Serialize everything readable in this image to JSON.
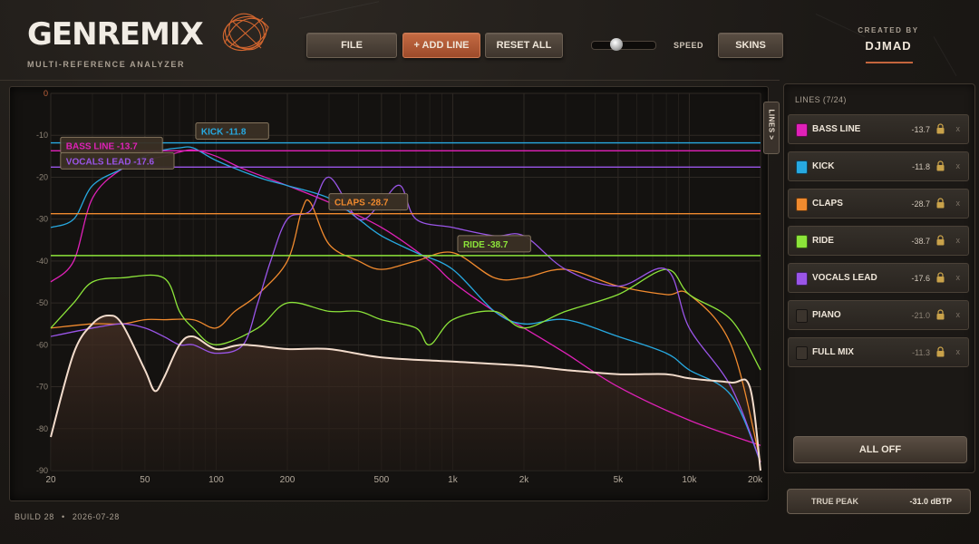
{
  "header": {
    "logo_text": "GENREMIX",
    "subtitle": "MULTI-REFERENCE ANALYZER",
    "buttons": {
      "file": "FILE",
      "add_line": "+ ADD LINE",
      "reset_all": "RESET ALL",
      "skins": "SKINS"
    },
    "speed_label": "SPEED",
    "speed_level": 0.38,
    "created_by_label": "CREATED BY",
    "author": "DJMAD"
  },
  "graph": {
    "lines_tab_label": "LINES >",
    "callouts": [
      {
        "name": "BASS LINE",
        "value": "-13.7"
      },
      {
        "name": "VOCALS LEAD",
        "value": "-17.6"
      },
      {
        "name": "KICK",
        "value": "-11.8"
      },
      {
        "name": "CLAPS",
        "value": "-28.7"
      },
      {
        "name": "RIDE",
        "value": "-38.7"
      }
    ]
  },
  "panel": {
    "heading": "LINES",
    "count": "(7/24)",
    "rows": [
      {
        "name": "BASS LINE",
        "value": "-13.7",
        "color": "#e021b8",
        "active": true
      },
      {
        "name": "KICK",
        "value": "-11.8",
        "color": "#27a9e1",
        "active": true
      },
      {
        "name": "CLAPS",
        "value": "-28.7",
        "color": "#f08a2e",
        "active": true
      },
      {
        "name": "RIDE",
        "value": "-38.7",
        "color": "#8ce43a",
        "active": true
      },
      {
        "name": "VOCALS LEAD",
        "value": "-17.6",
        "color": "#9a55e8",
        "active": true
      },
      {
        "name": "PIANO",
        "value": "-21.0",
        "color": "#3b342d",
        "active": false
      },
      {
        "name": "FULL MIX",
        "value": "-11.3",
        "color": "#3b342d",
        "active": false
      }
    ],
    "all_off_label": "ALL OFF"
  },
  "true_peak": {
    "label": "TRUE PEAK",
    "value": "-31.0 dBTP"
  },
  "footer": {
    "build": "BUILD 28",
    "date": "2026-07-28",
    "separator": "•"
  },
  "chart_data": {
    "type": "line",
    "x_scale": "log",
    "xlim": [
      20,
      20000
    ],
    "ylim": [
      -90,
      0
    ],
    "x_ticks": [
      "20",
      "50",
      "100",
      "200",
      "500",
      "1k",
      "2k",
      "5k",
      "10k",
      "20k"
    ],
    "y_ticks": [
      "0",
      "-10",
      "-20",
      "-30",
      "-40",
      "-50",
      "-60",
      "-70",
      "-80",
      "-90"
    ],
    "grid": true,
    "reference_lines": [
      {
        "name": "KICK",
        "value": -11.8,
        "color": "#27a9e1"
      },
      {
        "name": "BASS LINE",
        "value": -13.7,
        "color": "#e021b8"
      },
      {
        "name": "VOCALS LEAD",
        "value": -17.6,
        "color": "#9a55e8"
      },
      {
        "name": "CLAPS",
        "value": -28.7,
        "color": "#f08a2e"
      },
      {
        "name": "RIDE",
        "value": -38.7,
        "color": "#8ce43a"
      }
    ],
    "series": [
      {
        "name": "BASS LINE",
        "color": "#e021b8",
        "x": [
          20,
          25,
          30,
          40,
          50,
          60,
          70,
          80,
          100,
          130,
          200,
          300,
          500,
          800,
          1000,
          1500,
          2000,
          3000,
          5000,
          10000,
          20000
        ],
        "y": [
          -45,
          -40,
          -25,
          -18,
          -16,
          -15,
          -14,
          -13.5,
          -15,
          -18,
          -22,
          -26,
          -32,
          -40,
          -45,
          -52,
          -56,
          -62,
          -70,
          -78,
          -84
        ]
      },
      {
        "name": "KICK",
        "color": "#27a9e1",
        "x": [
          20,
          25,
          30,
          40,
          50,
          60,
          70,
          80,
          100,
          150,
          200,
          300,
          400,
          500,
          700,
          1000,
          1500,
          2000,
          3000,
          5000,
          8000,
          10000,
          15000,
          20000
        ],
        "y": [
          -32,
          -30,
          -22,
          -18,
          -15,
          -13.5,
          -13,
          -13,
          -16,
          -20,
          -22,
          -25,
          -30,
          -34,
          -38,
          -42,
          -52,
          -55,
          -54,
          -58,
          -62,
          -66,
          -72,
          -88
        ]
      },
      {
        "name": "CLAPS",
        "color": "#f08a2e",
        "x": [
          20,
          30,
          40,
          50,
          60,
          80,
          100,
          120,
          150,
          200,
          230,
          250,
          300,
          400,
          500,
          700,
          1000,
          1500,
          2000,
          3000,
          5000,
          8000,
          10000,
          15000,
          20000
        ],
        "y": [
          -56,
          -55,
          -55,
          -54,
          -54,
          -54,
          -56,
          -52,
          -48,
          -40,
          -28,
          -26,
          -36,
          -40,
          -42,
          -40,
          -38,
          -44,
          -44,
          -42,
          -46,
          -48,
          -48,
          -60,
          -88
        ]
      },
      {
        "name": "RIDE",
        "color": "#8ce43a",
        "x": [
          20,
          25,
          30,
          40,
          60,
          70,
          80,
          100,
          150,
          200,
          300,
          400,
          500,
          700,
          800,
          1000,
          1500,
          2000,
          3000,
          5000,
          8000,
          10000,
          15000,
          20000
        ],
        "y": [
          -56,
          -50,
          -45,
          -44,
          -44,
          -52,
          -56,
          -60,
          -56,
          -50,
          -52,
          -52,
          -54,
          -56,
          -60,
          -54,
          -52,
          -56,
          -52,
          -48,
          -42,
          -48,
          -54,
          -66
        ]
      },
      {
        "name": "VOCALS LEAD",
        "color": "#9a55e8",
        "x": [
          20,
          30,
          40,
          50,
          60,
          70,
          80,
          100,
          130,
          150,
          170,
          200,
          250,
          300,
          400,
          500,
          600,
          700,
          1000,
          1500,
          2000,
          3000,
          5000,
          8000,
          10000,
          15000,
          20000
        ],
        "y": [
          -58,
          -56,
          -55,
          -56,
          -58,
          -60,
          -60,
          -62,
          -60,
          -50,
          -40,
          -30,
          -28,
          -20,
          -30,
          -26,
          -22,
          -30,
          -32,
          -34,
          -34,
          -42,
          -46,
          -42,
          -56,
          -70,
          -88
        ]
      },
      {
        "name": "FULL MIX",
        "color": "#f3dccc",
        "x": [
          20,
          25,
          30,
          35,
          40,
          50,
          55,
          60,
          70,
          80,
          100,
          130,
          200,
          300,
          500,
          1000,
          2000,
          3000,
          5000,
          8000,
          10000,
          15000,
          18000,
          20000
        ],
        "y": [
          -82,
          -62,
          -55,
          -53,
          -55,
          -66,
          -71,
          -68,
          -60,
          -58,
          -61,
          -60,
          -61,
          -61,
          -63,
          -64,
          -65,
          -66,
          -67,
          -67,
          -68,
          -69,
          -70,
          -90
        ]
      }
    ]
  }
}
